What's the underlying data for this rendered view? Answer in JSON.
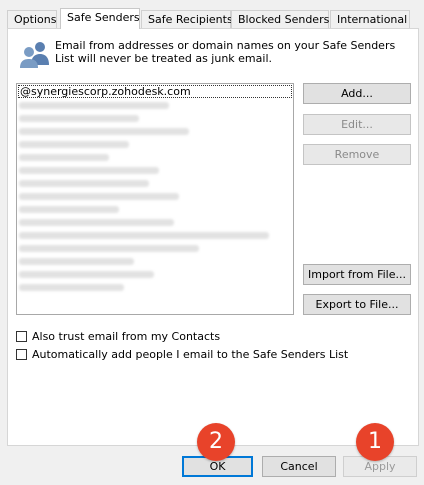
{
  "tabs": [
    "Options",
    "Safe Senders",
    "Safe Recipients",
    "Blocked Senders",
    "International"
  ],
  "active_tab": "Safe Senders",
  "description": "Email from addresses or domain names on your Safe Senders List will never be treated as junk email.",
  "list": {
    "first_entry": "@synergiescorp.zohodesk.com"
  },
  "buttons": {
    "add": "Add...",
    "edit": "Edit...",
    "remove": "Remove",
    "import": "Import from File...",
    "export": "Export to File..."
  },
  "checkboxes": {
    "trust_contacts": "Also trust email from my Contacts",
    "auto_add": "Automatically add people I email to the Safe Senders List"
  },
  "dialog_buttons": {
    "ok": "OK",
    "cancel": "Cancel",
    "apply": "Apply"
  },
  "callouts": {
    "ok_marker": "2",
    "apply_marker": "1"
  },
  "colors": {
    "callout": "#e8432a",
    "default_button_border": "#0078d7"
  }
}
